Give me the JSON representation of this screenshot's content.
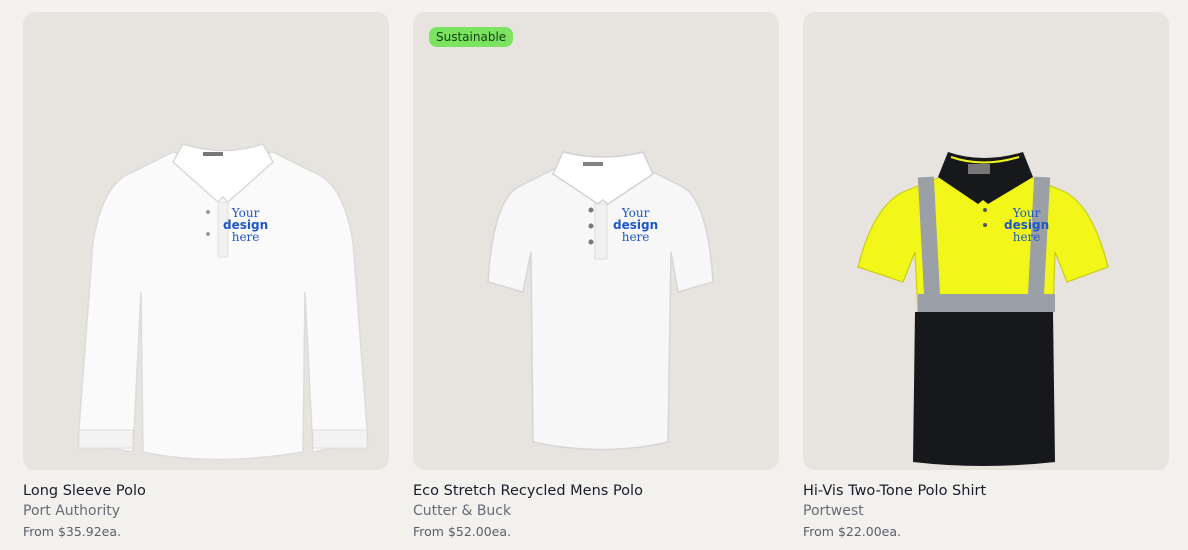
{
  "products": [
    {
      "title": "Long Sleeve Polo",
      "brand": "Port Authority",
      "price": "From $35.92ea.",
      "badge": "",
      "image_icon": "white-long-sleeve-polo",
      "design_placeholder": [
        "Your",
        "design",
        "here"
      ],
      "colors": {
        "shirt": "#fafafa",
        "accent": "#1d57c7"
      }
    },
    {
      "title": "Eco Stretch Recycled Mens Polo",
      "brand": "Cutter & Buck",
      "price": "From $52.00ea.",
      "badge": "Sustainable",
      "image_icon": "white-short-sleeve-polo",
      "design_placeholder": [
        "Your",
        "design",
        "here"
      ],
      "colors": {
        "shirt": "#f7f7f7",
        "badge": "#7be35f"
      }
    },
    {
      "title": "Hi-Vis Two-Tone Polo Shirt",
      "brand": "Portwest",
      "price": "From $22.00ea.",
      "badge": "",
      "image_icon": "hi-vis-yellow-black-polo",
      "design_placeholder": [
        "Your",
        "design",
        "here"
      ],
      "colors": {
        "yellow": "#f2f719",
        "black": "#17181c",
        "reflective": "#9aa0a6"
      }
    }
  ]
}
